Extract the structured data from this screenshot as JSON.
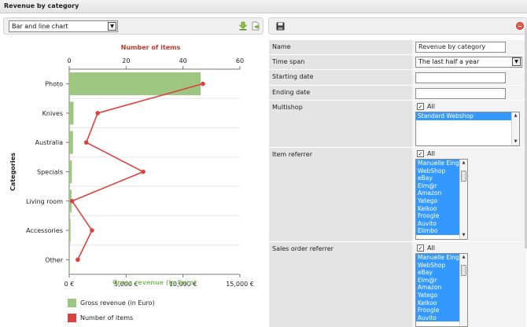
{
  "window": {
    "title": "Revenue by category"
  },
  "left_toolbar": {
    "chart_type": "Bar and line chart",
    "icons": [
      "download-icon",
      "export-icon"
    ]
  },
  "right_toolbar": {
    "icons": [
      "save-icon",
      "delete-icon"
    ]
  },
  "form": {
    "name": {
      "label": "Name",
      "value": "Revenue by category"
    },
    "time_span": {
      "label": "Time span",
      "value": "The last half a year"
    },
    "starting_date": {
      "label": "Starting date",
      "value": ""
    },
    "ending_date": {
      "label": "Ending date",
      "value": ""
    },
    "multishop": {
      "label": "Multishop",
      "all_label": "All",
      "all_checked": true,
      "items": [
        "Standard Webshop"
      ]
    },
    "item_referrer": {
      "label": "Item referrer",
      "all_label": "All",
      "all_checked": true,
      "items": [
        "Manuelle Eing",
        "WebShop",
        "eBay",
        "Elm@r",
        "Amazon",
        "Yatego",
        "Kelkoo",
        "Froogle",
        "Auvito",
        "Elimbo"
      ]
    },
    "sales_order_referrer": {
      "label": "Sales order referrer",
      "all_label": "All",
      "all_checked": true,
      "items": [
        "Manuelle Eing",
        "WebShop",
        "eBay",
        "Elm@r",
        "Amazon",
        "Yatego",
        "Kelkoo",
        "Froogle",
        "Auvito"
      ]
    }
  },
  "chart_data": {
    "type": "bar",
    "categories": [
      "Photo",
      "Knives",
      "Australia",
      "Specials",
      "Living room",
      "Accessories",
      "Other"
    ],
    "series": [
      {
        "name": "Gross revenue (in Euro)",
        "type": "bar",
        "color": "#9dc781",
        "axis": "bottom",
        "values": [
          11550,
          380,
          330,
          230,
          200,
          120,
          60
        ]
      },
      {
        "name": "Number of items",
        "type": "line",
        "color": "#d9423f",
        "axis": "top",
        "values": [
          47,
          10,
          6,
          26,
          1,
          8,
          3
        ]
      }
    ],
    "ylabel": "Categories",
    "xlabel_bottom": "Gross revenue (in Euro)",
    "xlabel_top": "Number of items",
    "xlim_bottom": [
      0,
      15000
    ],
    "xticks_bottom": [
      "0 €",
      "5,000 €",
      "10,000 €",
      "15,000 €"
    ],
    "xlim_top": [
      0,
      60
    ],
    "xticks_top": [
      "0",
      "20",
      "40",
      "60"
    ],
    "grid": true,
    "legend_position": "bottom-left",
    "colors": {
      "bar": "#9dc781",
      "line": "#d9423f",
      "top_axis_title": "#c0392b",
      "bottom_axis_title": "#8cc06e"
    }
  }
}
